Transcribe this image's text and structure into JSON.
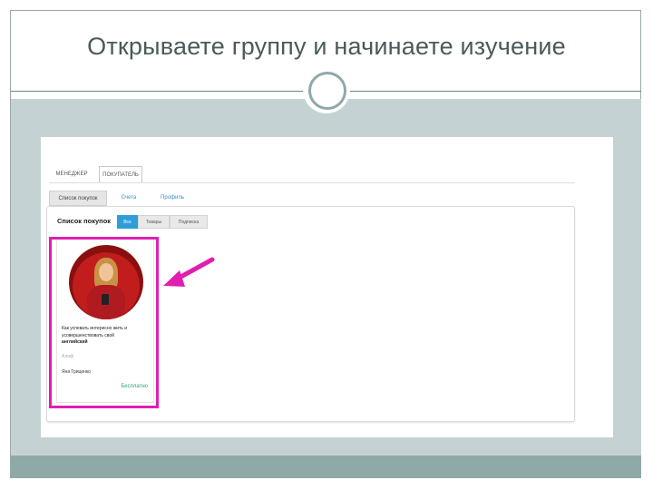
{
  "slide": {
    "title": "Открываете группу и начинаете изучение",
    "colors": {
      "accent": "#8fa9a9",
      "background": "#c5d2d3",
      "highlight": "#e01fb0",
      "link": "#3a8fbf",
      "active_filter": "#2f9ed8",
      "price": "#2aa36b"
    }
  },
  "app": {
    "role_tabs": [
      "МЕНЕДЖЕР",
      "ПОКУПАТЕЛЬ"
    ],
    "sub_tabs": [
      "Список покупок",
      "Счета",
      "Профиль"
    ],
    "list_heading": "Список покупок",
    "filters": [
      "Все",
      "Товары",
      "Подписка"
    ],
    "card": {
      "title_line1": "Как успевать интересно жить и",
      "title_line2": "усовершенствовать свой",
      "title_bold": "английский",
      "author": "Алиф",
      "person": "Яна Гриценко",
      "price": "Бесплатно",
      "image": "woman-in-red-photo"
    }
  },
  "icons": {
    "ornament": "ring-ornament-icon",
    "pointer": "pointer-arrow-icon"
  }
}
